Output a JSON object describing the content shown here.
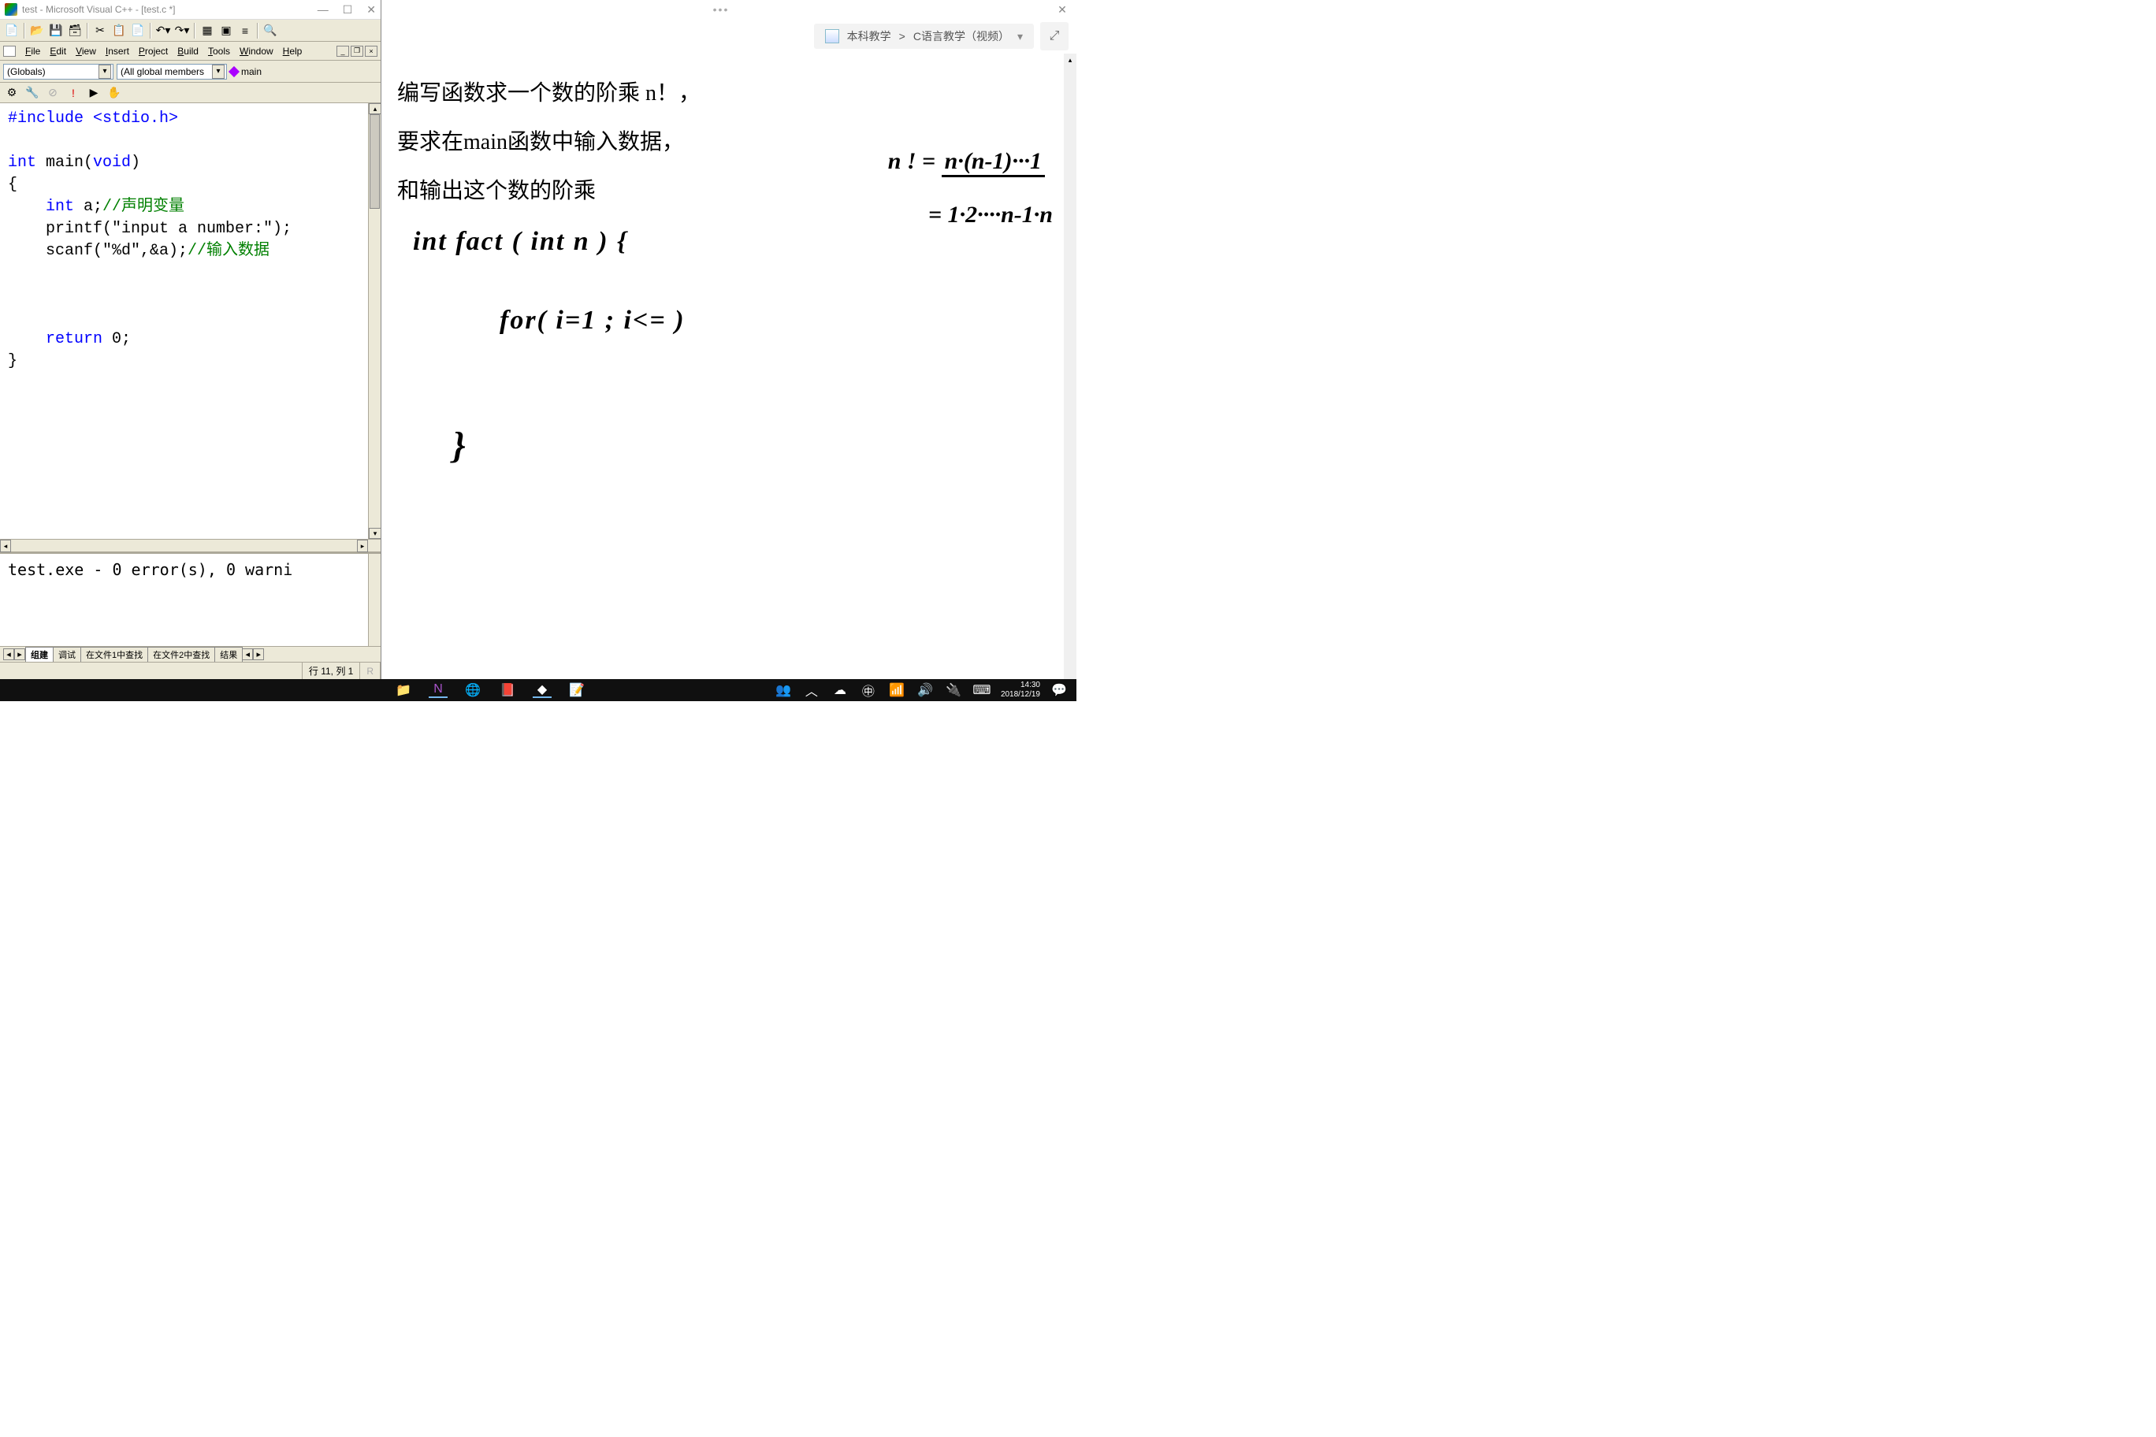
{
  "vcpp": {
    "title": "test - Microsoft Visual C++ - [test.c *]",
    "menus": [
      "File",
      "Edit",
      "View",
      "Insert",
      "Project",
      "Build",
      "Tools",
      "Window",
      "Help"
    ],
    "combo1": "(Globals)",
    "combo2": "(All global members",
    "main_label": "main",
    "code_lines": [
      {
        "t": "#include <stdio.h>",
        "cls": "kw"
      },
      {
        "t": ""
      },
      {
        "t": "int main(void)",
        "parts": [
          {
            "t": "int",
            "c": "kw"
          },
          {
            "t": " main(",
            "c": "fn"
          },
          {
            "t": "void",
            "c": "kw"
          },
          {
            "t": ")",
            "c": "fn"
          }
        ]
      },
      {
        "t": "{"
      },
      {
        "t": "    int a;//声明变量",
        "parts": [
          {
            "t": "    ",
            "c": "fn"
          },
          {
            "t": "int",
            "c": "kw"
          },
          {
            "t": " a;",
            "c": "fn"
          },
          {
            "t": "//声明变量",
            "c": "cm"
          }
        ]
      },
      {
        "t": "    printf(\"input a number:\");"
      },
      {
        "t": "    scanf(\"%d\",&a);//输入数据",
        "parts": [
          {
            "t": "    scanf(\"%d\",&a);",
            "c": "fn"
          },
          {
            "t": "//输入数据",
            "c": "cm"
          }
        ]
      },
      {
        "t": ""
      },
      {
        "t": ""
      },
      {
        "t": ""
      },
      {
        "t": "    return 0;",
        "parts": [
          {
            "t": "    ",
            "c": "fn"
          },
          {
            "t": "return",
            "c": "kw"
          },
          {
            "t": " 0;",
            "c": "fn"
          }
        ]
      },
      {
        "t": "}"
      }
    ],
    "output_text": "test.exe - 0 error(s), 0 warni",
    "output_tabs": [
      "组建",
      "调试",
      "在文件1中查找",
      "在文件2中查找",
      "结果"
    ],
    "status_pos": "行 11, 列 1",
    "status_r": "R"
  },
  "onenote": {
    "breadcrumb_parent": "本科教学",
    "breadcrumb_sep": ">",
    "breadcrumb_child": "C语言教学（视频）",
    "problem_l1": "编写函数求一个数的阶乘 n！，",
    "problem_l2": "要求在main函数中输入数据，",
    "problem_l3": "和输出这个数的阶乘",
    "hw_formula1a": "n ! =",
    "hw_formula1b": "n·(n-1)···1",
    "hw_formula2": "= 1·2····n-1·n",
    "hw_code1": "int   fact ( int  n  ) {",
    "hw_code2": "for( i=1 ; i<=      )",
    "hw_code3": "}"
  },
  "taskbar": {
    "time": "14:30",
    "date": "2018/12/19"
  }
}
